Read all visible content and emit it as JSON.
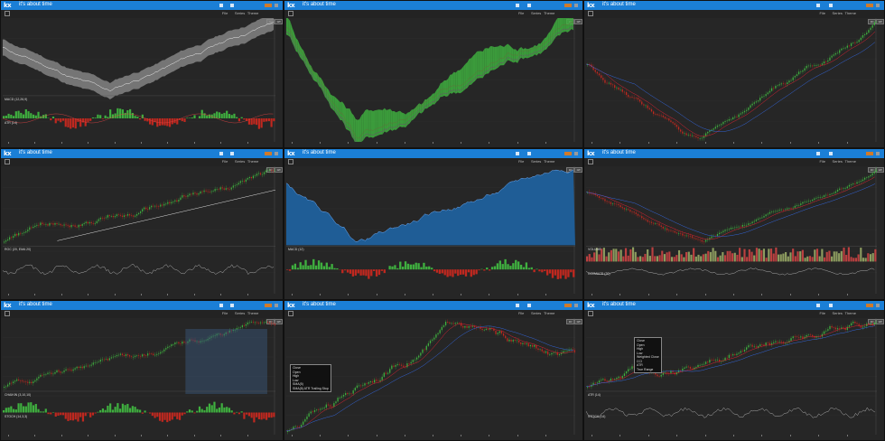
{
  "app": {
    "brand": "kx",
    "tagline": "it's about time"
  },
  "toolbar": {
    "menu_labels": [
      "File",
      "Series",
      "Theme"
    ],
    "orange_label": "Live",
    "zoom_labels": [
      "1D",
      "1W"
    ]
  },
  "panels": [
    {
      "id": "p1",
      "lower_label": "MACD (12,26,9)",
      "mid_label": "ATR (14)"
    },
    {
      "id": "p2",
      "lower_label": ""
    },
    {
      "id": "p3",
      "lower_label": ""
    },
    {
      "id": "p4",
      "lower_label": "ROC (20, EMA 20)"
    },
    {
      "id": "p5",
      "lower_label": "MACD (12)"
    },
    {
      "id": "p6",
      "lower_label": "VOLUME",
      "mid_label": "CCI/MACD (20)"
    },
    {
      "id": "p7",
      "lower_label": "CHAIKIN (3,10,10)",
      "mid_label": "STOCH (14,3,3)"
    },
    {
      "id": "p8",
      "lower_label": ""
    },
    {
      "id": "p9",
      "lower_label": "ATR (14)",
      "mid_label": "STOCH (14)"
    }
  ],
  "tooltips": {
    "p8": "Close\nOpen\nHigh\nLow\nSMA(5)\nSMA(8) ATR Trailing Stop",
    "p9": "Close\nOpen\nHigh\nLow\nWeighted Close\nCCI\nATR\nTrue Range"
  },
  "icons": {
    "brand": "kx-logo",
    "tools": [
      "bar-chart-icon",
      "grid-icon",
      "settings-icon"
    ]
  },
  "colors": {
    "topbar": "#1b7fd6",
    "panel_bg": "#262626",
    "up": "#3fb03f",
    "down": "#c0281f",
    "blue_fill": "#1f5d96"
  }
}
